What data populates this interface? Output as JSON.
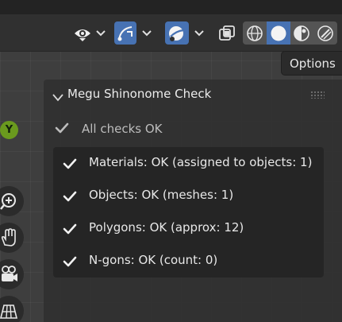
{
  "header": {
    "icons": [
      "visibility-eye-icon",
      "dropdown-chevron-icon",
      "gizmo-curve-icon",
      "dropdown-chevron-icon",
      "overlay-sphere-icon",
      "dropdown-chevron-icon",
      "xray-toggle-icon"
    ],
    "shading_modes": [
      "wireframe-shading-icon",
      "solid-shading-icon",
      "material-shading-icon",
      "rendered-shading-icon"
    ],
    "active_shading": "solid",
    "accent_color": "#4772b3"
  },
  "options_label": "Options",
  "navigation": {
    "axis_label": "Y",
    "axis_color": "#6a9a1e",
    "icons": [
      "zoom-icon",
      "pan-hand-icon",
      "camera-icon",
      "grid-ortho-icon"
    ]
  },
  "panel": {
    "title": "Megu Shinonome Check",
    "summary": "All checks OK",
    "checks": [
      {
        "label": "Materials: OK (assigned to objects: 1)"
      },
      {
        "label": "Objects: OK (meshes: 1)"
      },
      {
        "label": "Polygons: OK (approx: 12)"
      },
      {
        "label": "N-gons: OK (count: 0)"
      }
    ]
  }
}
